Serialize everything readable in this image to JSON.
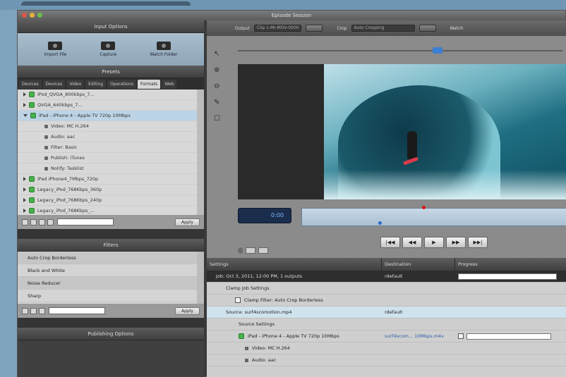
{
  "window": {
    "title": "Episode Session"
  },
  "left": {
    "input_options_title": "Input Options",
    "input_buttons": [
      {
        "label": "Import File",
        "icon": "import-file-icon"
      },
      {
        "label": "Capture",
        "icon": "video-camera-icon"
      },
      {
        "label": "Watch Folder",
        "icon": "folder-icon"
      }
    ],
    "presets_title": "Presets",
    "tabs": [
      "Devices",
      "Devices",
      "Video",
      "Editing",
      "Operations",
      "Formats",
      "Web"
    ],
    "preset_items": [
      {
        "label": "iPod_QVGA_800kbps_7...",
        "open": false
      },
      {
        "label": "QVGA_640kbps_7...",
        "open": false
      },
      {
        "label": "iPad - iPhone 4 - Apple TV 720p 10Mbps",
        "open": true,
        "selected": true
      },
      {
        "label": "iPad iPhone4_7Mbps_720p",
        "open": false
      },
      {
        "label": "Legacy_iPod_768Kbps_360p",
        "open": false
      },
      {
        "label": "Legacy_iPod_768Kbps_240p",
        "open": false
      },
      {
        "label": "Legacy_iPod_768Kbps_...",
        "open": false
      }
    ],
    "preset_subitems": [
      "Video: MC H.264",
      "Audio: aac",
      "Filter: Basic",
      "Publish: iTunes",
      "Notify: Tasklist"
    ],
    "apply_label": "Apply",
    "filters_title": "Filters",
    "filters": [
      "Auto Crop Borderless",
      "Black and White",
      "Noise Reducer",
      "Sharp"
    ],
    "filters_apply_label": "Apply",
    "publishing_title": "Publishing Options"
  },
  "right": {
    "toolbar": {
      "output_label": "Output",
      "output_value": "Clip 1-Mr-MOV-0000",
      "crop_label": "Crop",
      "crop_value": "Auto Cropping",
      "watch_label": "Watch"
    },
    "timecode": "0:00",
    "transport": [
      "|◀◀",
      "◀◀",
      "▶",
      "▶▶",
      "▶▶|"
    ],
    "table": {
      "headers": [
        "Settings",
        "Destination",
        "Progress"
      ],
      "rows": [
        {
          "text": "Job: Oct 3, 2011, 12:00 PM, 1 outputs",
          "dest": "rdefault",
          "kind": "job"
        },
        {
          "text": "Clamp Job Settings",
          "dest": "",
          "kind": "sub1"
        },
        {
          "text": "Clamp Filter: Auto Crop Borderless",
          "dest": "",
          "kind": "sub2"
        },
        {
          "text": "Source: surf4scomotion.mp4",
          "dest": "rdefault",
          "kind": "source"
        },
        {
          "text": "Source Settings",
          "dest": "",
          "kind": "sub2"
        },
        {
          "text": "iPad - iPhone 4 - Apple TV 720p 10Mbps",
          "dest": "surf4scom... 10Mbps.m4v",
          "kind": "preset"
        },
        {
          "text": "Video: MC H.264",
          "dest": "",
          "kind": "sub3"
        },
        {
          "text": "Audio: aac",
          "dest": "",
          "kind": "sub3"
        }
      ]
    }
  }
}
